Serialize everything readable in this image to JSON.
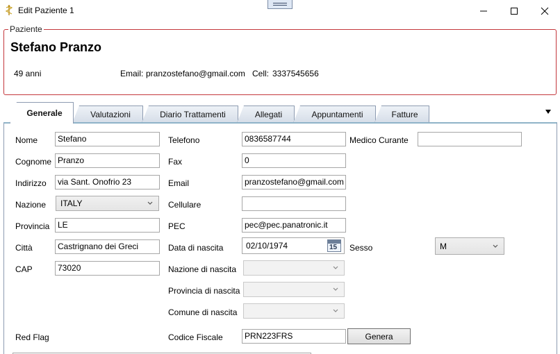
{
  "window": {
    "title": "Edit Paziente 1"
  },
  "patient": {
    "legend": "Paziente",
    "name": "Stefano Pranzo",
    "age": "49 anni",
    "email_label": "Email:",
    "email": "pranzostefano@gmail.com",
    "cell_label": "Cell:",
    "cell": "3337545656"
  },
  "tabs": [
    "Generale",
    "Valutazioni",
    "Diario Trattamenti",
    "Allegati",
    "Appuntamenti",
    "Fatture"
  ],
  "active_tab": "Generale",
  "form": {
    "nome": {
      "label": "Nome",
      "value": "Stefano"
    },
    "cognome": {
      "label": "Cognome",
      "value": "Pranzo"
    },
    "indirizzo": {
      "label": "Indirizzo",
      "value": "via Sant. Onofrio 23"
    },
    "nazione": {
      "label": "Nazione",
      "value": "ITALY"
    },
    "provincia": {
      "label": "Provincia",
      "value": "LE"
    },
    "citta": {
      "label": "Città",
      "value": "Castrignano dei Greci"
    },
    "cap": {
      "label": "CAP",
      "value": "73020"
    },
    "red_flag": {
      "label": "Red Flag"
    },
    "telefono": {
      "label": "Telefono",
      "value": "0836587744"
    },
    "fax": {
      "label": "Fax",
      "value": "0"
    },
    "email": {
      "label": "Email",
      "value": "pranzostefano@gmail.com"
    },
    "cellulare": {
      "label": "Cellulare",
      "value": ""
    },
    "pec": {
      "label": "PEC",
      "value": "pec@pec.panatronic.it"
    },
    "data_nascita": {
      "label": "Data di nascita",
      "value": "02/10/1974",
      "cal_day": "15"
    },
    "nazione_nascita": {
      "label": "Nazione di nascita",
      "value": ""
    },
    "provincia_nascita": {
      "label": "Provincia di nascita",
      "value": ""
    },
    "comune_nascita": {
      "label": "Comune di nascita",
      "value": ""
    },
    "codice_fiscale": {
      "label": "Codice Fiscale",
      "value": "PRN223FRS"
    },
    "genera_button": "Genera",
    "medico_curante": {
      "label": "Medico Curante",
      "value": ""
    },
    "sesso": {
      "label": "Sesso",
      "value": "M"
    }
  },
  "icons": {
    "app": "caduceus-icon",
    "minimize": "minimize-icon",
    "maximize": "maximize-icon",
    "close": "close-icon",
    "tab_overflow": "triangle-down-icon",
    "calendar": "calendar-icon"
  },
  "colors": {
    "group_border": "#c4373c",
    "tab_border": "#8d9bb1"
  }
}
